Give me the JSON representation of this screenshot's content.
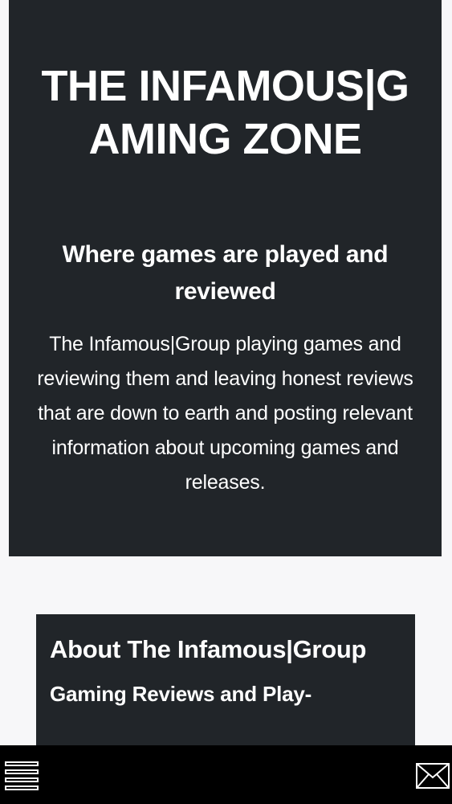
{
  "hero": {
    "title": "THE INFAMOUS|GAMING ZONE",
    "subtitle": "Where games are played and reviewed",
    "description": "The Infamous|Group playing games and reviewing them and leaving honest reviews that are down to earth and posting relevant information about upcoming games and releases."
  },
  "about": {
    "title": "About The Infamous|Group",
    "subtitle": "Gaming Reviews and Play-"
  },
  "bottom_bar": {
    "menu_icon": "hamburger-menu-icon",
    "mail_icon": "envelope-icon"
  },
  "colors": {
    "panel_background": "#212529",
    "page_background": "#f7f7f9",
    "bar_background": "#000000",
    "text": "#ffffff"
  }
}
